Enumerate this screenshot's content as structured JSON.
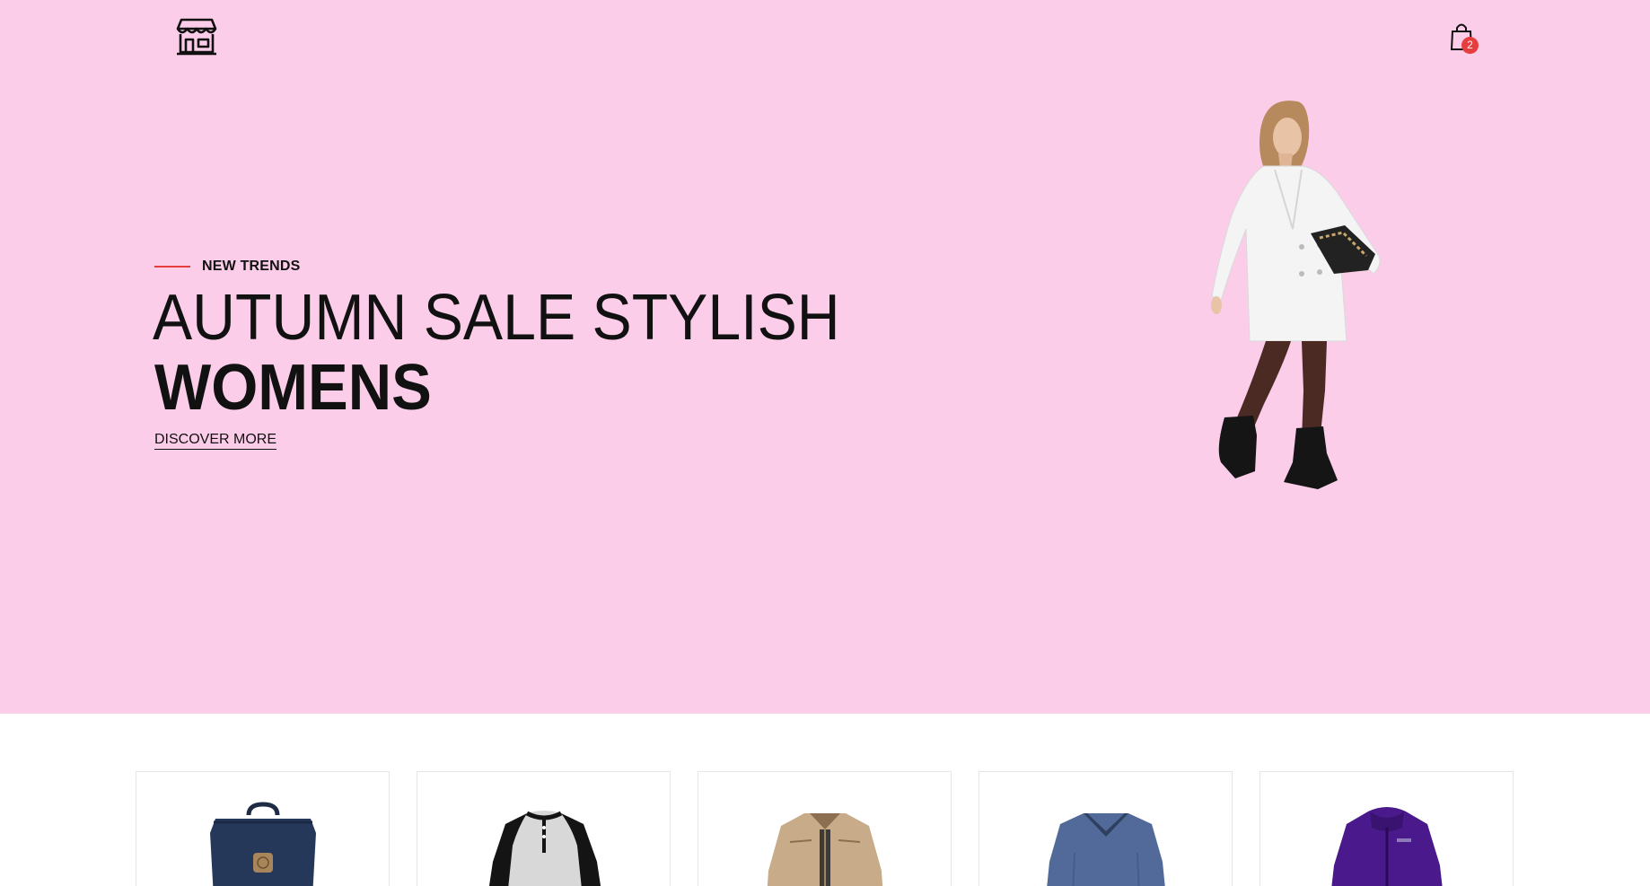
{
  "header": {
    "logo_icon": "storefront-icon",
    "cart_icon": "shopping-bag-icon",
    "cart_count": "2",
    "badge_color": "#e63e3e"
  },
  "hero": {
    "background": "#fbcde9",
    "eyebrow": "NEW TRENDS",
    "headline_line1": "AUTUMN SALE STYLISH",
    "headline_line2": "WOMENS",
    "cta_label": "DISCOVER MORE",
    "image_subject": "model-in-white-coat"
  },
  "products": [
    {
      "item": "navy-backpack"
    },
    {
      "item": "raglan-henley-shirt"
    },
    {
      "item": "beige-jacket"
    },
    {
      "item": "blue-v-neck-sweater"
    },
    {
      "item": "purple-rain-jacket"
    }
  ]
}
